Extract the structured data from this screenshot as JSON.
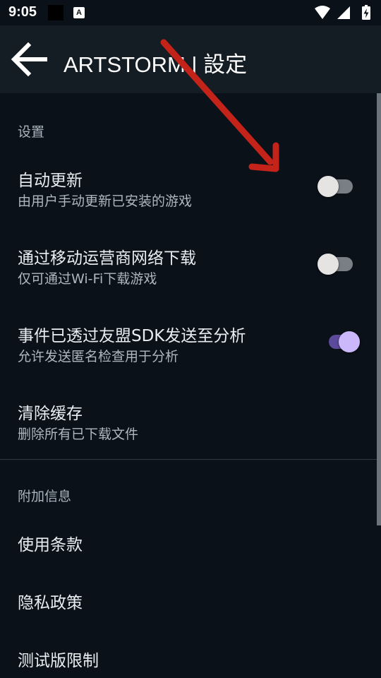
{
  "status_bar": {
    "time": "9:05",
    "notification_letter": "A",
    "icons": [
      "wifi-icon",
      "signal-icon",
      "battery-charging-icon"
    ]
  },
  "app_bar": {
    "back_icon": "arrow-left-icon",
    "title": "ARTSTORM | 設定"
  },
  "settings": {
    "header": "设置",
    "items": [
      {
        "title": "自动更新",
        "summary": "由用户手动更新已安装的游戏",
        "switch_on": false
      },
      {
        "title": "通过移动运营商网络下载",
        "summary": "仅可通过Wi-Fi下载游戏",
        "switch_on": false
      },
      {
        "title": "事件已透过友盟SDK发送至分析",
        "summary": "允许发送匿名检查用于分析",
        "switch_on": true
      },
      {
        "title": "清除缓存",
        "summary": "删除所有已下载文件"
      }
    ]
  },
  "additional_info": {
    "header": "附加信息",
    "items": [
      {
        "title": "使用条款"
      },
      {
        "title": "隐私政策"
      },
      {
        "title": "测试版限制"
      }
    ]
  },
  "colors": {
    "background": "#0a1118",
    "app_bar": "#141c24",
    "switch_on_thumb": "#cbb8fb",
    "switch_on_track": "#5c4b9a",
    "annotation_arrow": "#c4231a"
  }
}
